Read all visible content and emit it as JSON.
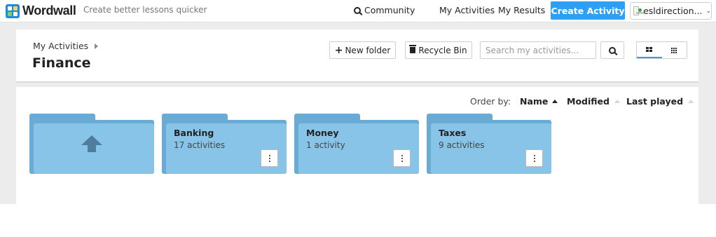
{
  "header": {
    "brand": "Wordwall",
    "tagline": "Create better lessons quicker",
    "nav": {
      "community": "Community",
      "my_activities": "My Activities",
      "my_results": "My Results"
    },
    "create_activity": "Create Activity",
    "user_name": "esldirection...",
    "icons": {
      "logo": "wordwall-logo-icon",
      "community": "search-icon",
      "user": "avatar-icon",
      "menu": "chevron-down-icon"
    }
  },
  "breadcrumb": {
    "parent": "My Activities",
    "current_folder": "Finance"
  },
  "toolbar": {
    "new_folder_label": "New folder",
    "recycle_bin_label": "Recycle Bin",
    "search_placeholder": "Search my activities...",
    "view_modes": [
      "large-grid-icon",
      "small-grid-icon"
    ],
    "active_view": "large-grid-icon"
  },
  "sort": {
    "order_by_label": "Order by:",
    "options": [
      {
        "label": "Name",
        "active": true
      },
      {
        "label": "Modified",
        "active": false
      },
      {
        "label": "Last played",
        "active": false
      }
    ]
  },
  "folders": [
    {
      "type": "up",
      "icon": "arrow-up-icon"
    },
    {
      "name": "Banking",
      "count": "17 activities"
    },
    {
      "name": "Money",
      "count": "1 activity"
    },
    {
      "name": "Taxes",
      "count": "9 activities"
    }
  ],
  "colors": {
    "accent": "#2da0f5",
    "folder_front": "#87c4e8",
    "folder_back": "#69abd4"
  }
}
